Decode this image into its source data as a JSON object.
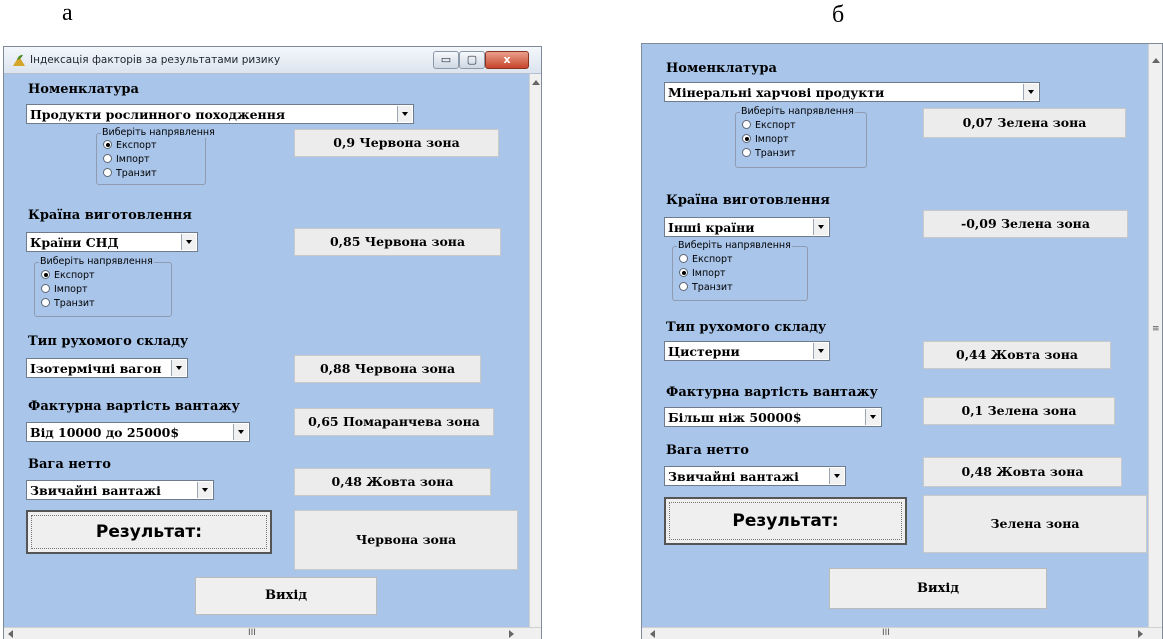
{
  "letters": {
    "a": "а",
    "b": "б"
  },
  "window_a": {
    "title": "Індексація факторів за результатами ризику",
    "minimize_glyph": "▭",
    "maximize_glyph": "▢",
    "close_glyph": "x",
    "nomenclature_label": "Номенклатура",
    "nomenclature_value": "Продукти рослинного походження",
    "direction1": {
      "legend": "Виберіть напрявлення",
      "options": [
        "Експорт",
        "Імпорт",
        "Транзит"
      ],
      "selected": "Експорт"
    },
    "result1": "0,9  Червона зона",
    "country_label": "Країна виготовлення",
    "country_value": "Країни СНД",
    "direction2": {
      "legend": "Виберіть напрявлення",
      "options": [
        "Експорт",
        "Імпорт",
        "Транзит"
      ],
      "selected": "Експорт"
    },
    "result2": "0,85  Червона зона",
    "stock_label": "Тип рухомого складу",
    "stock_value": "Ізотермічні вагон",
    "result3": "0,88  Червона зона",
    "cost_label": "Фактурна вартість вантажу",
    "cost_value": "Від 10000 до 25000$",
    "result4": "0,65  Помаранчева зона",
    "weight_label": "Вага нетто",
    "weight_value": "Звичайні вантажі",
    "result5": "0,48  Жовта зона",
    "result_button": "Результат:",
    "result_total": "Червона зона",
    "exit_button": "Вихід",
    "hscroll_grip": "III"
  },
  "window_b": {
    "nomenclature_label": "Номенклатура",
    "nomenclature_value": "Мінеральні харчові продукти",
    "direction1": {
      "legend": "Виберіть напрявлення",
      "options": [
        "Експорт",
        "Імпорт",
        "Транзит"
      ],
      "selected": "Імпорт"
    },
    "result1": "0,07  Зелена зона",
    "country_label": "Країна виготовлення",
    "country_value": "Інші країни",
    "direction2": {
      "legend": "Виберіть напрявлення",
      "options": [
        "Експорт",
        "Імпорт",
        "Транзит"
      ],
      "selected": "Імпорт"
    },
    "result2": "-0,09  Зелена зона",
    "stock_label": "Тип рухомого складу",
    "stock_value": "Цистерни",
    "result3": "0,44  Жовта зона",
    "cost_label": "Фактурна вартість вантажу",
    "cost_value": "Більш ніж 50000$",
    "result4": "0,1  Зелена зона",
    "weight_label": "Вага нетто",
    "weight_value": "Звичайні вантажі",
    "result5": "0,48  Жовта зона",
    "result_button": "Результат:",
    "result_total": "Зелена зона",
    "exit_button": "Вихід",
    "hscroll_grip": "III",
    "vscroll_grip": "≡"
  },
  "colors": {
    "panel": "#a9c5ea",
    "close": "#c6452b"
  }
}
